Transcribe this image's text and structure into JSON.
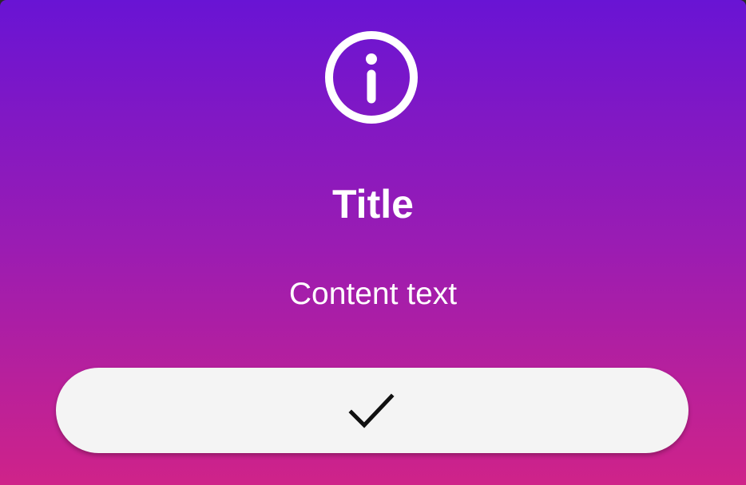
{
  "dialog": {
    "icon": "info-circle-icon",
    "title": "Title",
    "content": "Content text",
    "confirm_button": {
      "icon": "checkmark-icon"
    }
  },
  "colors": {
    "gradient_top": "#6914d4",
    "gradient_bottom": "#cf2389",
    "button_background": "#f4f4f4",
    "text": "#ffffff",
    "check": "#111111"
  }
}
